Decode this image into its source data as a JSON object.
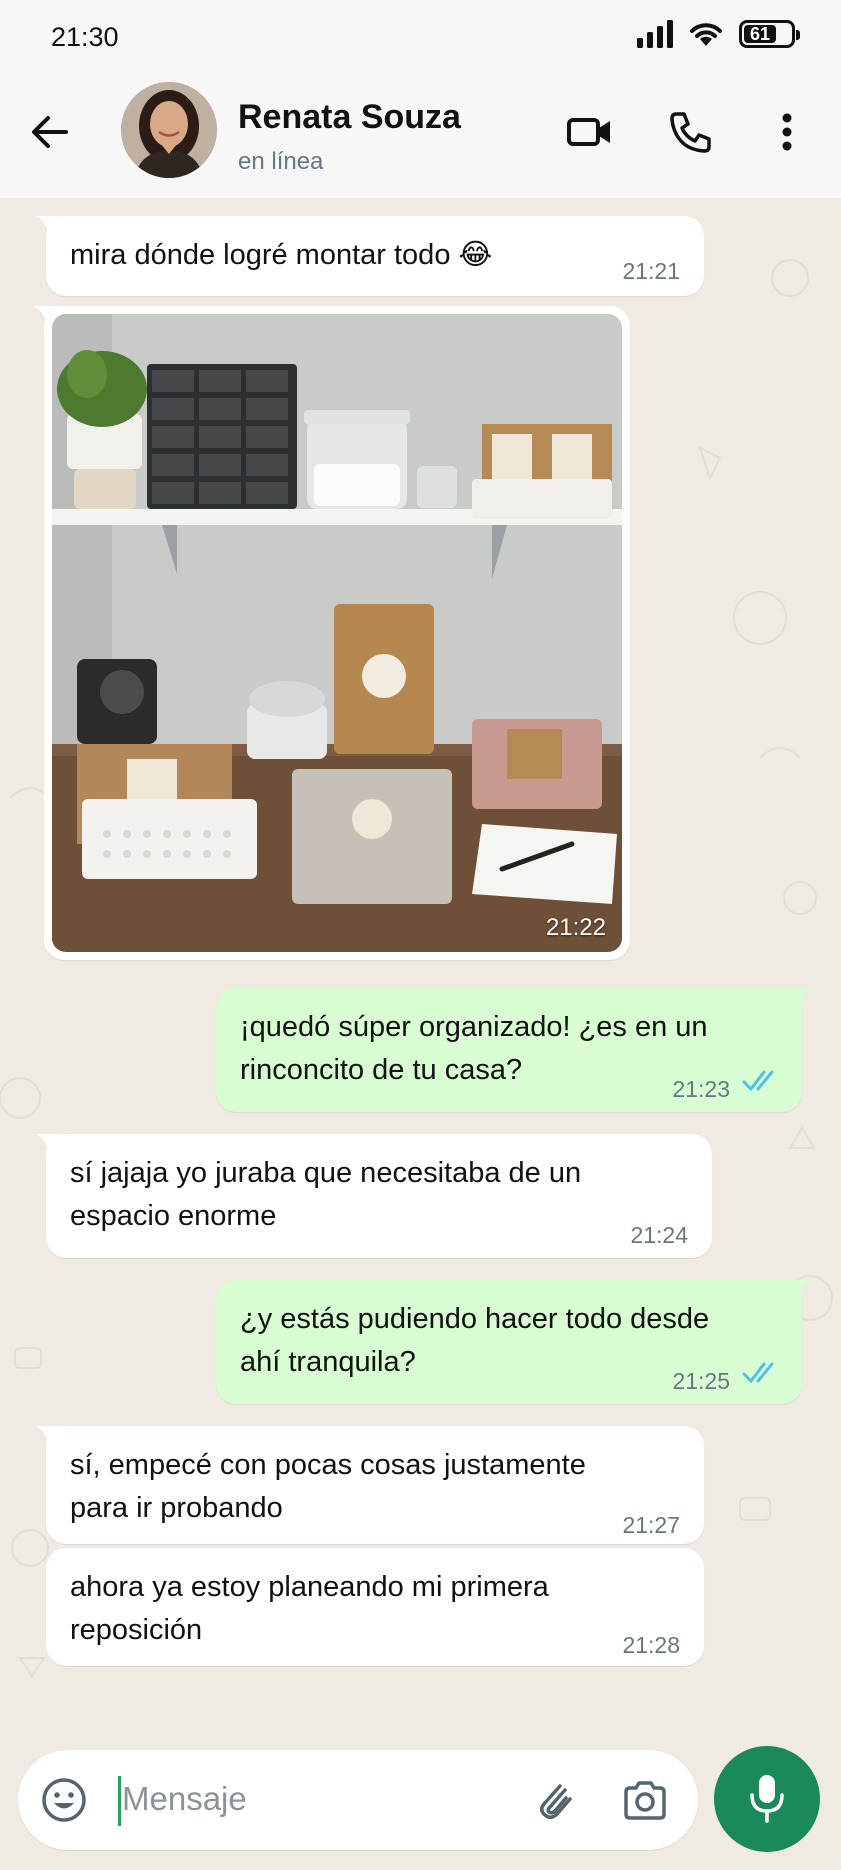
{
  "status_bar": {
    "time": "21:30",
    "battery": "61"
  },
  "header": {
    "name": "Renata Souza",
    "status": "en línea"
  },
  "messages": [
    {
      "dir": "in",
      "text": "mira dónde logré montar todo 😂",
      "time": "21:21"
    },
    {
      "dir": "in",
      "type": "image",
      "time": "21:22"
    },
    {
      "dir": "out",
      "line1": "¡quedó súper organizado! ¿es en un",
      "line2": "rinconcito de tu casa?",
      "time": "21:23"
    },
    {
      "dir": "in",
      "line1": "sí jajaja yo juraba que necesitaba de un",
      "line2": "espacio enorme",
      "time": "21:24"
    },
    {
      "dir": "out",
      "line1": "¿y estás pudiendo hacer todo desde",
      "line2": "ahí tranquila?",
      "time": "21:25"
    },
    {
      "dir": "in",
      "line1": "sí, empecé con pocas cosas justamente",
      "line2": "para ir probando",
      "time": "21:27"
    },
    {
      "dir": "in",
      "line1": "ahora ya estoy planeando mi primera",
      "line2": "reposición",
      "time": "21:28"
    }
  ],
  "input": {
    "placeholder": "Mensaje"
  },
  "colors": {
    "header_bg": "#f7f7f7",
    "chat_bg": "#efeae2",
    "outgoing_bubble": "#d9fdd3",
    "incoming_bubble": "#ffffff",
    "read_ticks": "#53bdeb",
    "mic_button": "#1a8a5a"
  },
  "icons": [
    "back-arrow-icon",
    "video-call-icon",
    "phone-icon",
    "more-vertical-icon",
    "emoji-icon",
    "attach-icon",
    "camera-icon",
    "mic-icon",
    "signal-icon",
    "wifi-icon",
    "battery-icon"
  ]
}
